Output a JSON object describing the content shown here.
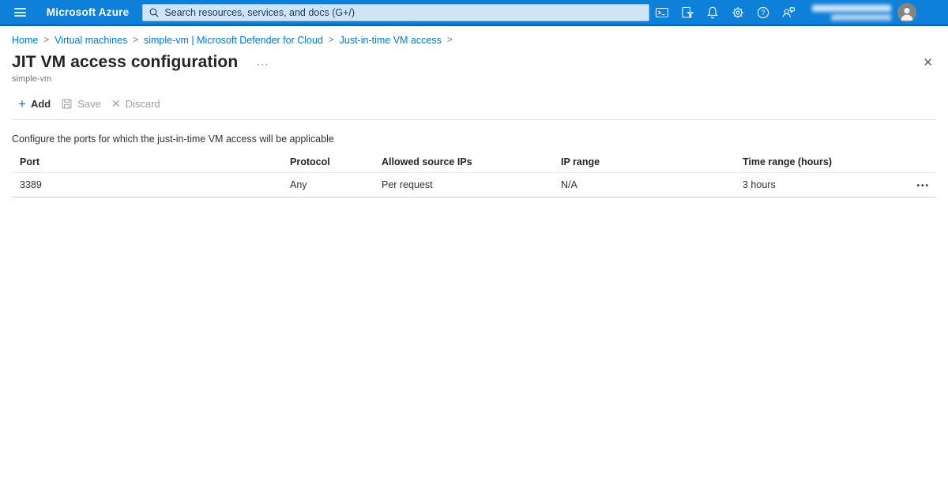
{
  "topbar": {
    "brand": "Microsoft Azure",
    "search_placeholder": "Search resources, services, and docs (G+/)",
    "colors": {
      "bar": "#0f80d9",
      "bar_border": "#0a64b0",
      "search_bg": "#cfe4f6",
      "link": "#0078d4"
    }
  },
  "breadcrumb": {
    "separator": ">",
    "items": [
      "Home",
      "Virtual machines",
      "simple-vm | Microsoft Defender for Cloud",
      "Just-in-time VM access"
    ]
  },
  "page": {
    "title": "JIT VM access configuration",
    "subtitle": "simple-vm",
    "more_icon": "···",
    "close_icon": "✕"
  },
  "toolbar": {
    "add_icon": "+",
    "add_label": "Add",
    "save_label": "Save",
    "discard_icon": "✕",
    "discard_label": "Discard"
  },
  "main": {
    "description": "Configure the ports for which the just-in-time VM access will be applicable"
  },
  "table": {
    "headers": [
      "Port",
      "Protocol",
      "Allowed source IPs",
      "IP range",
      "Time range (hours)"
    ],
    "rows": [
      {
        "port": "3389",
        "protocol": "Any",
        "allowed_source_ips": "Per request",
        "ip_range": "N/A",
        "time_range": "3 hours",
        "menu_icon": "•••"
      }
    ]
  }
}
